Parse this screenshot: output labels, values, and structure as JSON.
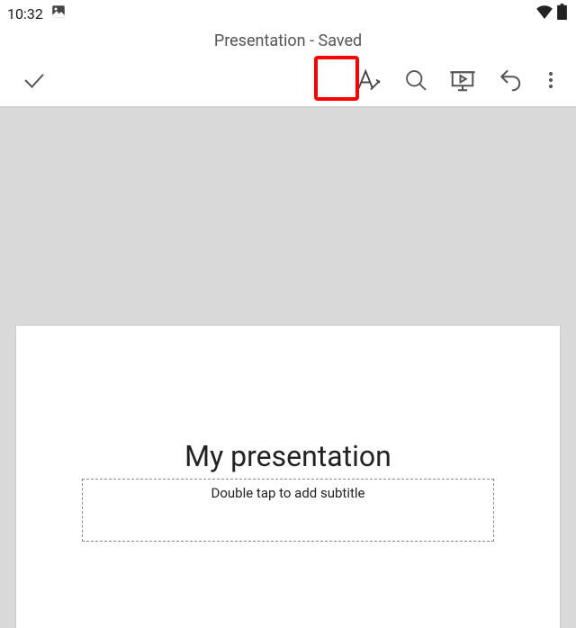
{
  "status": {
    "time": "10:32"
  },
  "header": {
    "title": "Presentation - Saved"
  },
  "slide": {
    "title": "My presentation",
    "subtitle_placeholder": "Double tap to add subtitle"
  }
}
